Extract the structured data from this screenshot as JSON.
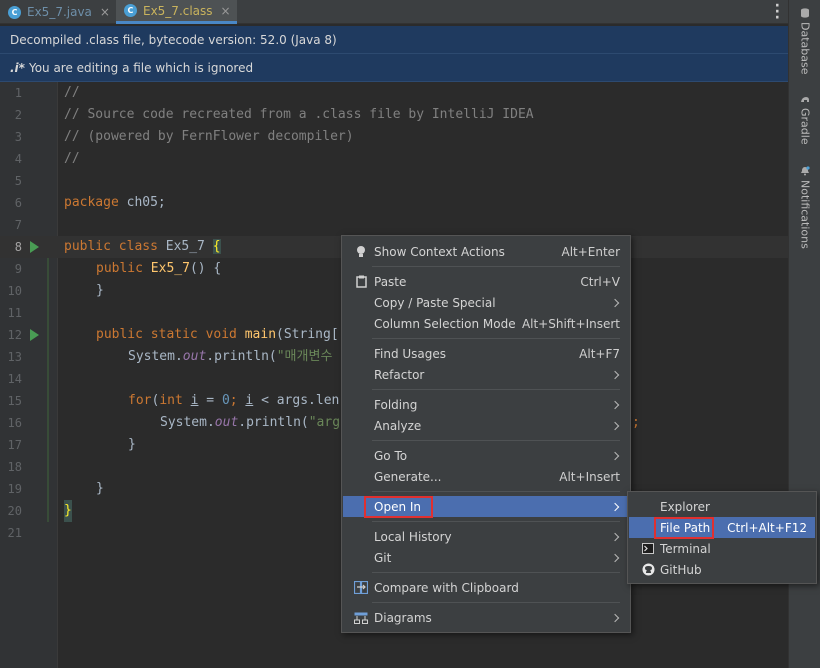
{
  "tabs": [
    {
      "label": "Ex5_7.java",
      "icon": "java-class-icon",
      "active": false
    },
    {
      "label": "Ex5_7.class",
      "icon": "java-class-icon",
      "active": true
    }
  ],
  "banners": {
    "decompiled": "Decompiled .class file, bytecode version: 52.0 (Java 8)",
    "ignored_prefix": ".i*",
    "ignored": "You are editing a file which is ignored"
  },
  "right_tools": [
    {
      "label": "Database",
      "icon": "database-icon"
    },
    {
      "label": "Gradle",
      "icon": "gradle-icon"
    },
    {
      "label": "Notifications",
      "icon": "bell-icon"
    }
  ],
  "code": {
    "line_numbers": [
      "1",
      "2",
      "3",
      "4",
      "5",
      "6",
      "7",
      "8",
      "9",
      "10",
      "11",
      "12",
      "13",
      "14",
      "15",
      "16",
      "17",
      "18",
      "19",
      "20",
      "21"
    ],
    "l1": "//",
    "l2": "// Source code recreated from a .class file by IntelliJ IDEA",
    "l3": "// (powered by FernFlower decompiler)",
    "l4": "//",
    "l6_kw": "package",
    "l6_rest": " ch05;",
    "l8_kw": "public class",
    "l8_name": " Ex5_7 ",
    "l8_brace": "{",
    "l9_kw": "public",
    "l9_fn": " Ex5_7",
    "l9_rest": "() {",
    "l10": "}",
    "l12_kw": "public static void",
    "l12_fn": " main",
    "l12_rest": "(String[",
    "l13_a": "System.",
    "l13_out": "out",
    "l13_b": ".println(",
    "l13_str": "\"매개변수",
    "l15_kw": "for",
    "l15_a": "(",
    "l15_int": "int",
    "l15_i": "i",
    "l15_b": " = ",
    "l15_zero": "0",
    "l15_c": "; ",
    "l15_i2": "i",
    "l15_d": " < args.len",
    "l16_a": "System.",
    "l16_out": "out",
    "l16_b": ".println(",
    "l16_str": "\"arg",
    "l16_tail": ";",
    "l17": "}",
    "l19": "}",
    "l20": "}"
  },
  "context_menu": {
    "items": [
      {
        "label": "Show Context Actions",
        "shortcut": "Alt+Enter",
        "icon": "bulb-icon"
      },
      {
        "label": "Paste",
        "shortcut": "Ctrl+V",
        "icon": "clipboard-icon"
      },
      {
        "label": "Copy / Paste Special",
        "shortcut": ""
      },
      {
        "label": "Column Selection Mode",
        "shortcut": "Alt+Shift+Insert"
      },
      {
        "label": "Find Usages",
        "shortcut": "Alt+F7"
      },
      {
        "label": "Refactor",
        "shortcut": ""
      },
      {
        "label": "Folding",
        "shortcut": ""
      },
      {
        "label": "Analyze",
        "shortcut": ""
      },
      {
        "label": "Go To",
        "shortcut": ""
      },
      {
        "label": "Generate...",
        "shortcut": "Alt+Insert"
      },
      {
        "label": "Open In",
        "shortcut": ""
      },
      {
        "label": "Local History",
        "shortcut": ""
      },
      {
        "label": "Git",
        "shortcut": ""
      },
      {
        "label": "Compare with Clipboard",
        "shortcut": "",
        "icon": "compare-icon"
      },
      {
        "label": "Diagrams",
        "shortcut": "",
        "icon": "diagram-icon"
      }
    ]
  },
  "open_in_submenu": {
    "items": [
      {
        "label": "Explorer",
        "shortcut": ""
      },
      {
        "label": "File Path",
        "shortcut": "Ctrl+Alt+F12"
      },
      {
        "label": "Terminal",
        "shortcut": "",
        "icon": "terminal-icon"
      },
      {
        "label": "GitHub",
        "shortcut": "",
        "icon": "github-icon"
      }
    ]
  },
  "colors": {
    "selection": "#4b6eaf",
    "highlight_box": "#e03030",
    "banner": "#1f3a5f"
  }
}
